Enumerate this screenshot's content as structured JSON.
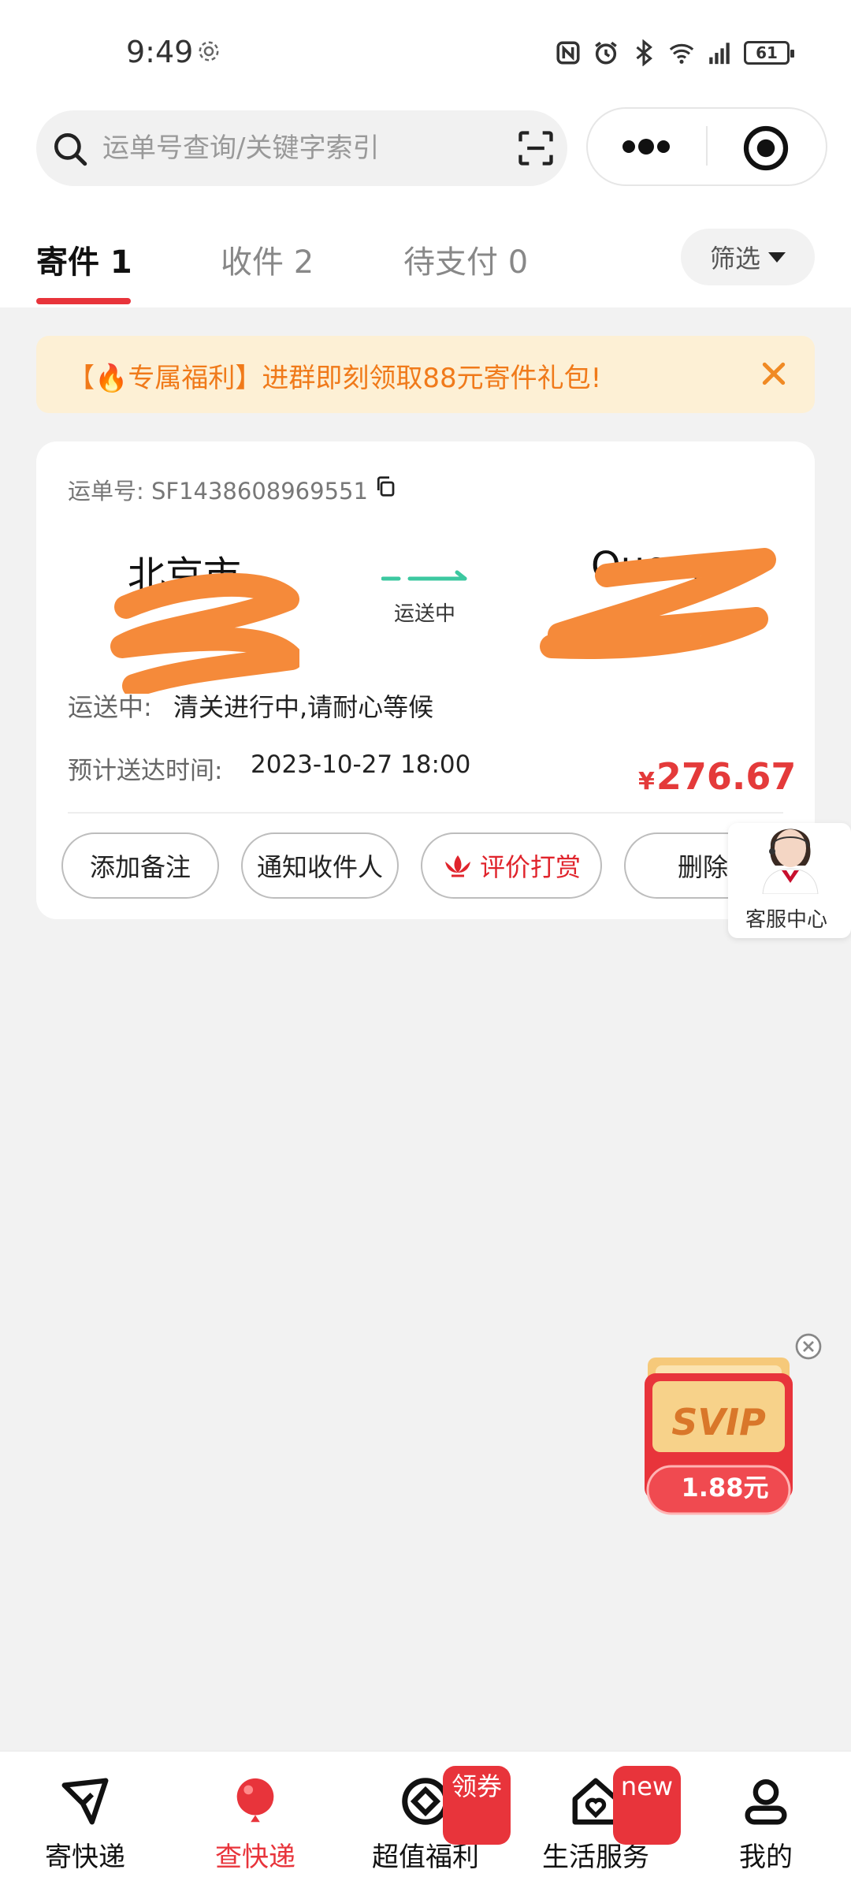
{
  "status_bar": {
    "time": "9:49",
    "battery": "61"
  },
  "search": {
    "placeholder": "运单号查询/关键字索引"
  },
  "tabs": [
    {
      "label": "寄件 1",
      "active": true
    },
    {
      "label": "收件 2",
      "active": false
    },
    {
      "label": "待支付 0",
      "active": false
    }
  ],
  "filter": {
    "label": "筛选"
  },
  "banner": {
    "text": "【🔥专属福利】进群即刻领取88元寄件礼包!"
  },
  "card": {
    "waybill_label": "运单号: SF1438608969551",
    "origin_city": "北京市",
    "dest_city": "Queens",
    "route_status": "运送中",
    "transit_label": "运送中:",
    "transit_text": "清关进行中,请耐心等候",
    "eta_label": "预计送达时间:",
    "eta_value": "2023-10-27 18:00",
    "price_currency": "¥",
    "price": "276.67",
    "buttons": {
      "add_note": "添加备注",
      "notify": "通知收件人",
      "review": "评价打赏",
      "delete": "删除"
    }
  },
  "customer_service": {
    "label": "客服中心"
  },
  "svip": {
    "label": "SVIP",
    "price": "1.88元"
  },
  "bottom_nav": [
    {
      "label": "寄快递",
      "icon": "paper-plane-icon",
      "active": false
    },
    {
      "label": "查快递",
      "icon": "balloon-icon",
      "active": true
    },
    {
      "label": "超值福利",
      "icon": "coin-icon",
      "active": false,
      "badge": "领券"
    },
    {
      "label": "生活服务",
      "icon": "home-heart-icon",
      "active": false,
      "badge": "new"
    },
    {
      "label": "我的",
      "icon": "person-icon",
      "active": false
    }
  ],
  "colors": {
    "accent": "#e8343b",
    "banner_bg": "#fdf0d5",
    "banner_text": "#f07a1a",
    "route_green": "#3cc8a0"
  }
}
